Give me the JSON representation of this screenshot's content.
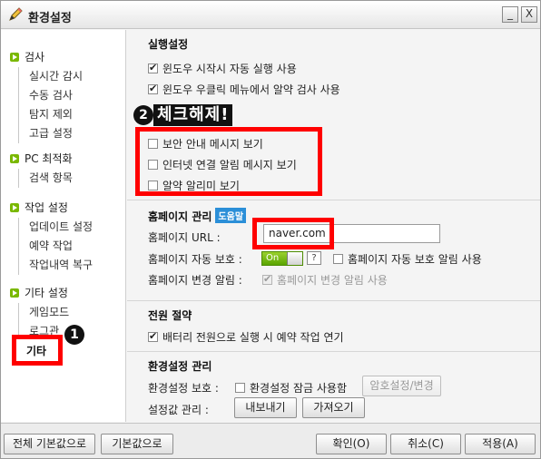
{
  "window": {
    "title": "환경설정",
    "minimize_glyph": "_",
    "close_glyph": "X"
  },
  "sidebar": {
    "categories": [
      {
        "label": "검사",
        "items": [
          "실시간 감시",
          "수동 검사",
          "탐지 제외",
          "고급 설정"
        ]
      },
      {
        "label": "PC 최적화",
        "items": [
          "검색 항목"
        ]
      },
      {
        "label": "작업 설정",
        "items": [
          "업데이트 설정",
          "예약 작업",
          "작업내역 복구"
        ]
      },
      {
        "label": "기타 설정",
        "items": [
          "게임모드",
          "로그관"
        ]
      }
    ],
    "selected_label": "기타"
  },
  "run": {
    "title": "실행설정",
    "options": [
      {
        "label": "윈도우 시작시 자동 실행 사용",
        "checked": true
      },
      {
        "label": "윈도우 우클릭 메뉴에서 알약 검사 사용",
        "checked": true
      }
    ]
  },
  "notify": {
    "options": [
      {
        "label": "보안 안내 메시지 보기",
        "checked": false
      },
      {
        "label": "인터넷 연결 알림 메시지 보기",
        "checked": false
      },
      {
        "label": "알약 알리미 보기",
        "checked": false
      }
    ]
  },
  "homepage": {
    "title": "홈페이지 관리",
    "help_label": "도움말",
    "url_label": "홈페이지 URL :",
    "url_value": "naver.com",
    "protect_label": "홈페이지 자동 보호 :",
    "toggle_label": "On",
    "q_glyph": "?",
    "protect_alert_label": "홈페이지 자동 보호 알림 사용",
    "change_alert_label": "홈페이지 변경 알림 :",
    "change_alert_option": "홈페이지 변경 알림 사용"
  },
  "power": {
    "title": "전원 절약",
    "option": "배터리 전원으로 실행 시 예약 작업 연기"
  },
  "env": {
    "title": "환경설정 관리",
    "protect_label": "환경설정 보호 :",
    "lock_option": "환경설정 잠금 사용함",
    "password_button": "암호설정/변경",
    "manage_label": "설정값 관리 :",
    "export_button": "내보내기",
    "import_button": "가져오기"
  },
  "footer": {
    "reset_all": "전체 기본값으로",
    "reset": "기본값으로",
    "ok": "확인(O)",
    "cancel": "취소(C)",
    "apply": "적용(A)"
  },
  "annotations": {
    "step1": "1",
    "step2": "2",
    "step2_text": "체크해제!",
    "highlight_color": "#ff0000"
  }
}
